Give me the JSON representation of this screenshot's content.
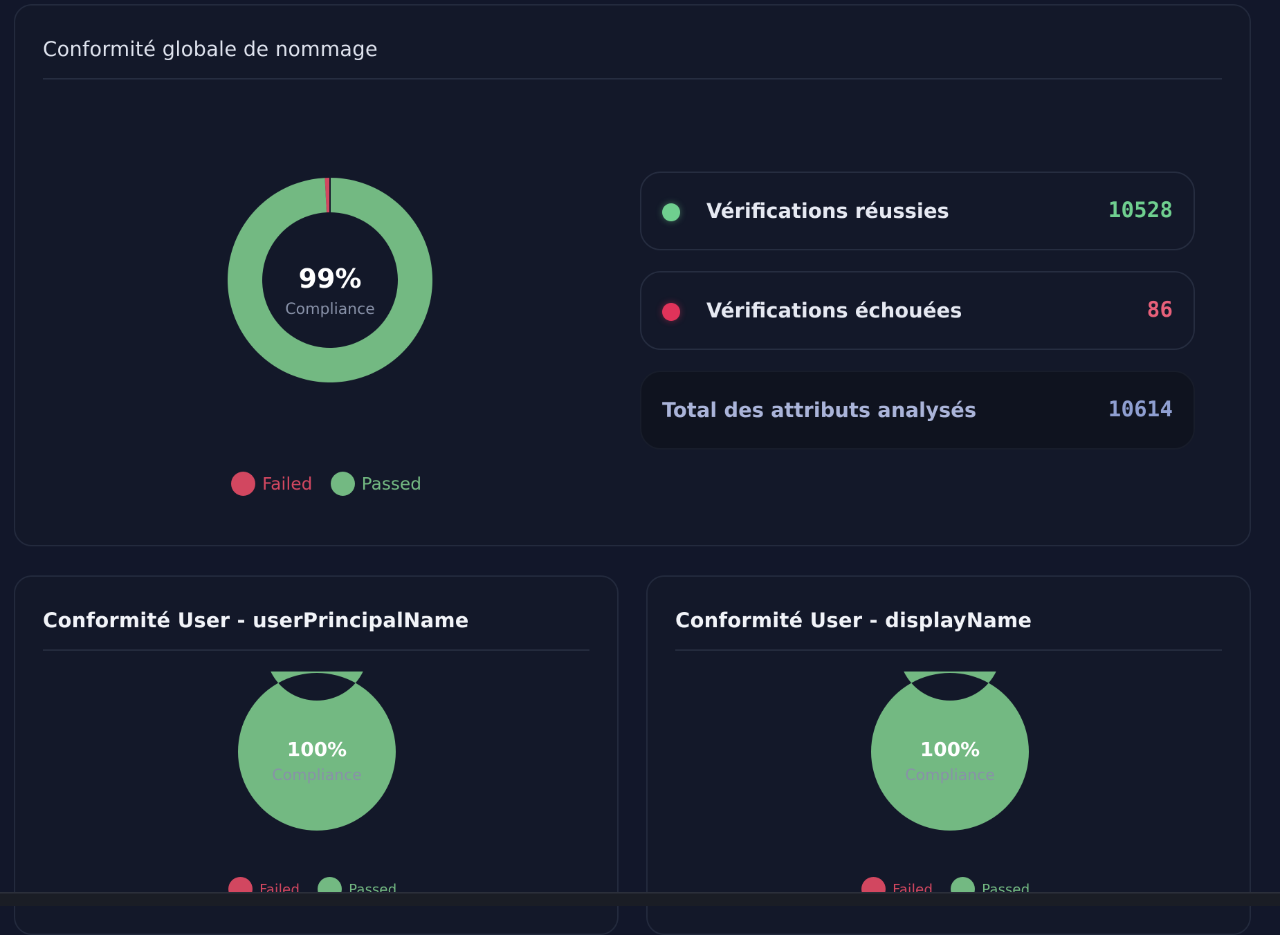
{
  "colors": {
    "passed": "#73b982",
    "failed": "#d24760",
    "failed_dot": "#e0335a",
    "passed_value": "#6fcf8f",
    "failed_value": "#e8607a",
    "total_value": "#8f9fd1",
    "total_label": "#aab4d9"
  },
  "global": {
    "title": "Conformité globale de nommage",
    "percent_label": "99%",
    "compliance_label": "Compliance",
    "legend": {
      "failed": "Failed",
      "passed": "Passed"
    },
    "stats": {
      "passed_label": "Vérifications réussies",
      "passed_value": "10528",
      "failed_label": "Vérifications échouées",
      "failed_value": "86",
      "total_label": "Total des attributs analysés",
      "total_value": "10614"
    }
  },
  "upn": {
    "title": "Conformité User - userPrincipalName",
    "percent_label": "100%",
    "compliance_label": "Compliance",
    "legend": {
      "failed": "Failed",
      "passed": "Passed"
    }
  },
  "display_name": {
    "title": "Conformité User - displayName",
    "percent_label": "100%",
    "compliance_label": "Compliance",
    "legend": {
      "failed": "Failed",
      "passed": "Passed"
    }
  },
  "chart_data": [
    {
      "type": "pie",
      "title": "Conformité globale de nommage",
      "categories": [
        "Failed",
        "Passed"
      ],
      "values": [
        86,
        10528
      ]
    },
    {
      "type": "pie",
      "title": "Conformité User - userPrincipalName",
      "categories": [
        "Failed",
        "Passed"
      ],
      "values": [
        0,
        100
      ]
    },
    {
      "type": "pie",
      "title": "Conformité User - displayName",
      "categories": [
        "Failed",
        "Passed"
      ],
      "values": [
        0,
        100
      ]
    }
  ]
}
